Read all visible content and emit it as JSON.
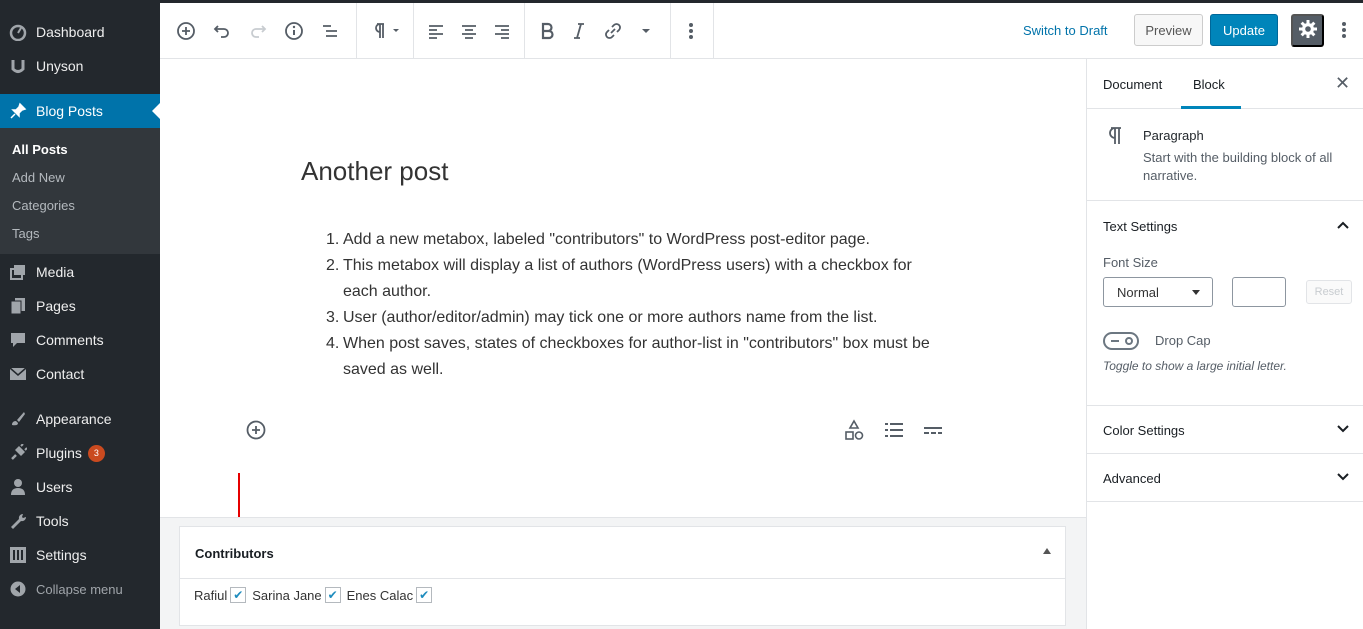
{
  "sidebar": {
    "items": [
      {
        "label": "Dashboard",
        "icon": "dashboard-icon"
      },
      {
        "label": "Unyson",
        "icon": "unyson-icon"
      },
      {
        "label": "Blog Posts",
        "icon": "pin-icon"
      },
      {
        "label": "Media",
        "icon": "media-icon"
      },
      {
        "label": "Pages",
        "icon": "pages-icon"
      },
      {
        "label": "Comments",
        "icon": "comments-icon"
      },
      {
        "label": "Contact",
        "icon": "mail-icon"
      },
      {
        "label": "Appearance",
        "icon": "brush-icon"
      },
      {
        "label": "Plugins",
        "icon": "plugins-icon",
        "badge": "3"
      },
      {
        "label": "Users",
        "icon": "users-icon"
      },
      {
        "label": "Tools",
        "icon": "wrench-icon"
      },
      {
        "label": "Settings",
        "icon": "settings-icon"
      }
    ],
    "submenu": [
      "All Posts",
      "Add New",
      "Categories",
      "Tags"
    ],
    "collapse_label": "Collapse menu"
  },
  "toolbar": {
    "switch_to_draft": "Switch to Draft",
    "preview": "Preview",
    "update": "Update"
  },
  "post": {
    "title": "Another post",
    "items": [
      {
        "num": "1.",
        "text": "Add a new metabox, labeled \"contributors\" to WordPress post-editor page."
      },
      {
        "num": "2.",
        "text": "This metabox will display a list of authors (WordPress users) with a checkbox for each author."
      },
      {
        "num": "3.",
        "text": "User (author/editor/admin) may tick one or more authors name from the list."
      },
      {
        "num": "4.",
        "text": "When post saves, states of checkboxes for author-list in \"contributors\" box must be saved as well."
      }
    ]
  },
  "metabox": {
    "title": "Contributors",
    "contributors": [
      {
        "name": "Rafiul",
        "checked": true
      },
      {
        "name": "Sarina Jane",
        "checked": true
      },
      {
        "name": "Enes Calac",
        "checked": true
      }
    ]
  },
  "inspector": {
    "tabs": [
      "Document",
      "Block"
    ],
    "active_tab": "Block",
    "block": {
      "title": "Paragraph",
      "description": "Start with the building block of all narrative."
    },
    "text_settings": {
      "title": "Text Settings",
      "font_size_label": "Font Size",
      "font_size_value": "Normal",
      "reset_label": "Reset",
      "drop_cap_label": "Drop Cap",
      "drop_cap_help": "Toggle to show a large initial letter."
    },
    "color_settings": "Color Settings",
    "advanced": "Advanced"
  },
  "colors": {
    "admin_dark": "#23282d",
    "accent": "#0073aa",
    "update_button": "#0085ba",
    "badge": "#ca4a1f",
    "annotation_arrow": "#e60000"
  }
}
